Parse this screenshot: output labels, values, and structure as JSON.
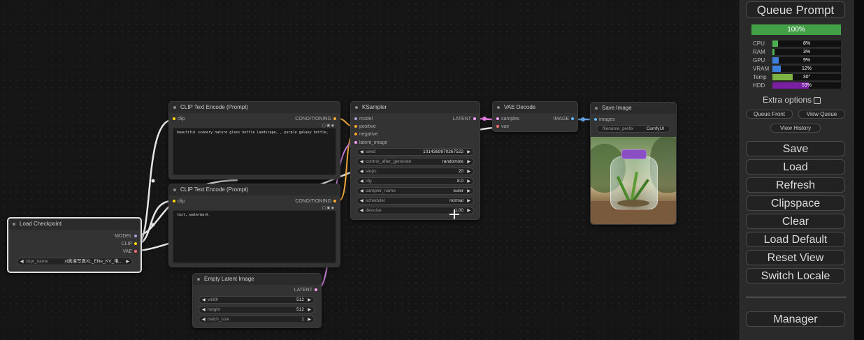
{
  "nodes": {
    "clip_pos": {
      "title": "CLIP Text Encode (Prompt)",
      "input": "clip",
      "output": "CONDITIONING",
      "text": "beautiful scenery nature glass bottle landscape, , purple galaxy bottle,"
    },
    "clip_neg": {
      "title": "CLIP Text Encode (Prompt)",
      "input": "clip",
      "output": "CONDITIONING",
      "text": "text, watermark"
    },
    "ksampler": {
      "title": "KSampler",
      "inputs": [
        "model",
        "positive",
        "negative",
        "latent_image"
      ],
      "output": "LATENT",
      "widgets": [
        {
          "label": "seed",
          "value": "1014369970267522"
        },
        {
          "label": "control_after_generate",
          "value": "randomize"
        },
        {
          "label": "steps",
          "value": "20"
        },
        {
          "label": "cfg",
          "value": "8.0"
        },
        {
          "label": "sampler_name",
          "value": "euler"
        },
        {
          "label": "scheduler",
          "value": "normal"
        },
        {
          "label": "denoise",
          "value": "1.00"
        }
      ]
    },
    "vae_decode": {
      "title": "VAE Decode",
      "inputs": [
        "samples",
        "vae"
      ],
      "output": "IMAGE"
    },
    "save_image": {
      "title": "Save Image",
      "input": "images",
      "prefix_label": "filename_prefix",
      "prefix_value": "ComfyUI"
    },
    "load_checkpoint": {
      "title": "Load Checkpoint",
      "outputs": [
        "MODEL",
        "CLIP",
        "VAE"
      ],
      "ckpt_label": "ckpt_name",
      "ckpt_value": "xl真境写真XL_Elite_KV_电..."
    },
    "empty_latent": {
      "title": "Empty Latent Image",
      "output": "LATENT",
      "widgets": [
        {
          "label": "width",
          "value": "512"
        },
        {
          "label": "height",
          "value": "512"
        },
        {
          "label": "batch_size",
          "value": "1"
        }
      ]
    }
  },
  "panel": {
    "queue_prompt": "Queue Prompt",
    "progress_text": "100%",
    "progress": 1.0,
    "stats": [
      {
        "name": "CPU",
        "value": "8%",
        "level": 0.08,
        "color": "#4caf50"
      },
      {
        "name": "RAM",
        "value": "3%",
        "level": 0.03,
        "color": "#4caf50"
      },
      {
        "name": "GPU",
        "value": "9%",
        "level": 0.09,
        "color": "#3f7fdc"
      },
      {
        "name": "VRAM",
        "value": "12%",
        "level": 0.12,
        "color": "#3f7fdc"
      },
      {
        "name": "Temp",
        "value": "30°",
        "level": 0.3,
        "color": "#7cb342"
      },
      {
        "name": "HDD",
        "value": "53%",
        "level": 0.53,
        "color": "#7b1fa2"
      }
    ],
    "extra_options": "Extra options",
    "queue_front": "Queue Front",
    "view_queue": "View Queue",
    "view_history": "View History",
    "buttons": [
      "Save",
      "Load",
      "Refresh",
      "Clipspace",
      "Clear",
      "Load Default",
      "Reset View",
      "Switch Locale"
    ],
    "manager": "Manager"
  },
  "colors": {
    "progress": "#43a047",
    "clip_link": "#ffd500",
    "model_link": "#b39ddb",
    "latent_link": "#ff9cf9",
    "conditioning_link": "#ffa931",
    "vae_link": "#ff6e6e",
    "image_link": "#64b5f6"
  }
}
